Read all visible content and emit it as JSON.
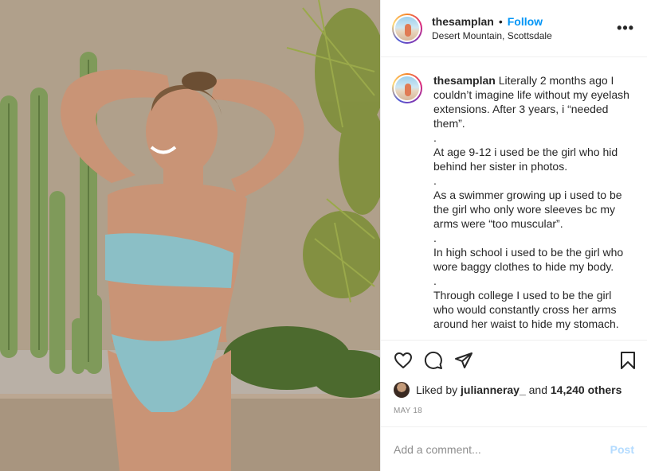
{
  "header": {
    "username": "thesamplan",
    "separator": "•",
    "follow_label": "Follow",
    "location": "Desert Mountain, Scottsdale",
    "more_icon": "more-horizontal-icon"
  },
  "caption": {
    "username": "thesamplan",
    "first_line": "Literally 2 months ago I couldn’t imagine life without my eyelash extensions. After 3 years, i “needed them”.",
    "paragraphs": [
      ".",
      "At age 9-12 i used be the girl who hid behind her sister in photos.",
      ".",
      "As a swimmer growing up i used to be the girl who only wore sleeves bc my arms were “too muscular”.",
      ".",
      "In high school i used to be the girl who wore baggy clothes to hide my body.",
      ".",
      "Through college I used to be the girl who would constantly cross her arms around her waist to hide my stomach."
    ]
  },
  "actions": {
    "like_icon": "heart-icon",
    "comment_icon": "comment-icon",
    "share_icon": "share-icon",
    "save_icon": "bookmark-icon"
  },
  "likes": {
    "prefix": "Liked by",
    "liker": "julianneray_",
    "joiner": "and",
    "others": "14,240 others"
  },
  "date": "MAY 18",
  "comment": {
    "placeholder": "Add a comment...",
    "post_label": "Post"
  }
}
